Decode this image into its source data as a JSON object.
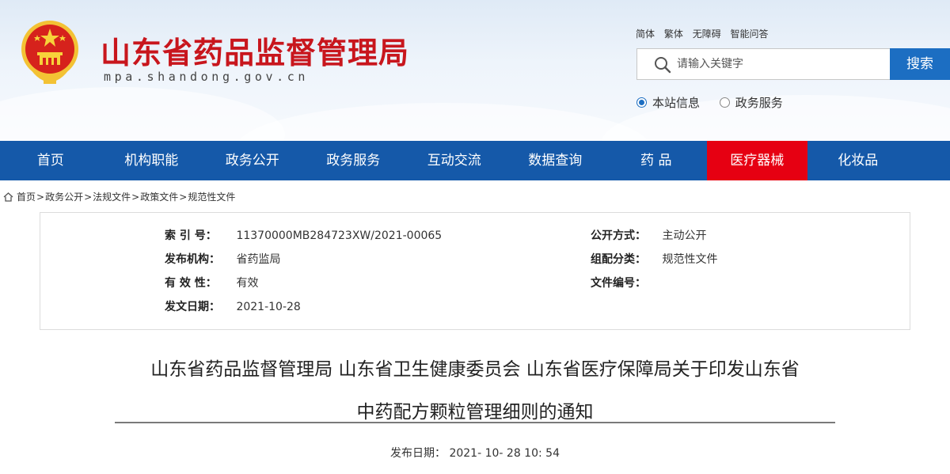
{
  "header": {
    "site_title": "山东省药品监督管理局",
    "domain": "mpa.shandong.gov.cn",
    "top_links": [
      "简体",
      "繁体",
      "无障碍",
      "智能问答"
    ],
    "search": {
      "placeholder": "请输入关键字",
      "button_label": "搜索"
    },
    "search_scope": [
      {
        "label": "本站信息",
        "checked": true
      },
      {
        "label": "政务服务",
        "checked": false
      }
    ]
  },
  "nav": {
    "items": [
      "首页",
      "机构职能",
      "政务公开",
      "政务服务",
      "互动交流",
      "数据查询",
      "药 品",
      "医疗器械",
      "化妆品"
    ],
    "active": "医疗器械"
  },
  "breadcrumb": [
    "首页",
    "政务公开",
    "法规文件",
    "政策文件",
    "规范性文件"
  ],
  "info": {
    "index_label": "索 引 号：",
    "index_value": "11370000MB284723XW/2021-00065",
    "issuer_label": "发布机构：",
    "issuer_value": "省药监局",
    "validity_label": "有 效 性：",
    "validity_value": "有效",
    "date_label": "发文日期：",
    "date_value": "2021-10-28",
    "open_label": "公开方式：",
    "open_value": "主动公开",
    "category_label": "组配分类：",
    "category_value": "规范性文件",
    "docno_label": "文件编号：",
    "docno_value": ""
  },
  "article": {
    "title_line1": "山东省药品监督管理局 山东省卫生健康委员会 山东省医疗保障局关于印发山东省",
    "title_line2": "中药配方颗粒管理细则的通知",
    "publish_date": "发布日期： 2021- 10- 28 10: 54"
  },
  "colors": {
    "brand_red": "#c8161d",
    "nav_blue": "#1559a9",
    "nav_active_red": "#e60012",
    "search_button_blue": "#1c6ec2"
  }
}
